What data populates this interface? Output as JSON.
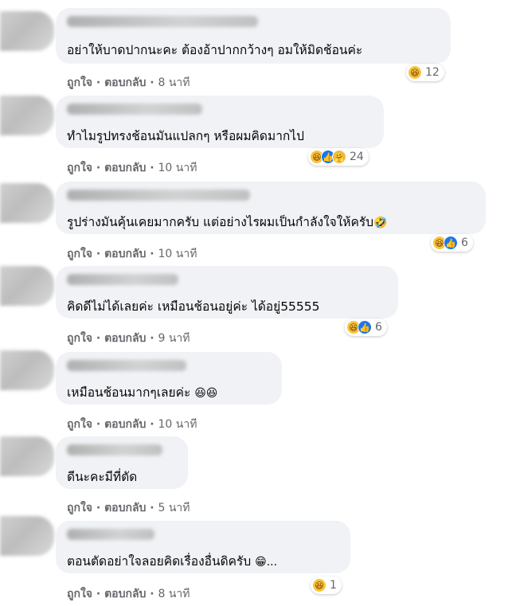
{
  "actions": {
    "like": "ถูกใจ",
    "reply": "ตอบกลับ"
  },
  "reaction_icons": {
    "haha": "😆",
    "like": "👍",
    "care": "🤗"
  },
  "comments": [
    {
      "text": "อย่าให้บาดปากนะคะ ต้องอ้าปากกว้างๆ อมให้มิดช้อนค่ะ",
      "time": "8 นาที",
      "reactions": [
        "haha"
      ],
      "count": "12"
    },
    {
      "text": "ทำไมรูปทรงช้อนมันแปลกๆ หรือผมคิดมากไป",
      "time": "10 นาที",
      "reactions": [
        "haha",
        "like",
        "care"
      ],
      "count": "24"
    },
    {
      "text": "รูปร่างมันคุ้นเคยมากครับ แต่อย่างไรผมเป็นกำลังใจให้ครับ",
      "emoji": "🤣",
      "time": "10 นาที",
      "reactions": [
        "haha",
        "like"
      ],
      "count": "6"
    },
    {
      "text": "คิดดีไม่ได้เลยค่ะ เหมือนช้อนอยู่ค่ะ ได้อยู่55555",
      "time": "9 นาที",
      "reactions": [
        "haha",
        "like"
      ],
      "count": "6"
    },
    {
      "text": "เหมือนช้อนมากๆเลยค่ะ",
      "emoji": "😆😆",
      "time": "10 นาที"
    },
    {
      "text": "ดีนะคะมีที่ตัด",
      "time": "5 นาที"
    },
    {
      "text": "ตอนตัดอย่าใจลอยคิดเรื่องอื่นดิครับ",
      "emoji": "😁...",
      "time": "8 นาที",
      "reactions": [
        "haha"
      ],
      "count": "1"
    }
  ]
}
